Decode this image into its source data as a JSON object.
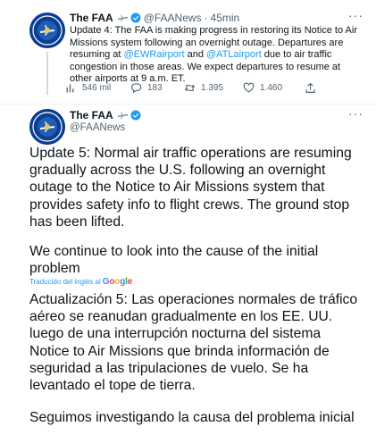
{
  "tweet1": {
    "name": "The FAA",
    "handle": "@FAANews",
    "separator": "·",
    "time": "45min",
    "more": "···",
    "text_part1": "Update 4: The FAA is making progress in restoring its Notice to Air Missions system following an overnight outage. Departures are resuming at ",
    "link1": "@EWRairport",
    "text_and": " and ",
    "link2": "@ATLairport",
    "text_part2": " due to air traffic congestion in those areas. We expect departures to resume at other airports at 9 a.m. ET.",
    "actions": {
      "views": "546 mil",
      "replies": "183",
      "retweets": "1.395",
      "likes": "1.460"
    }
  },
  "tweet2": {
    "name": "The FAA",
    "handle": "@FAANews",
    "more": "···",
    "paragraph1": "Update 5: Normal air traffic operations are resuming gradually across the U.S. following an overnight outage to the Notice to Air Missions system that provides safety info to flight crews. The ground stop has been lifted.",
    "paragraph2": "We continue to look into the cause of the initial problem",
    "translated_by": "Traducido del inglés al",
    "google": [
      "G",
      "o",
      "o",
      "g",
      "l",
      "e"
    ],
    "translation1": "Actualización 5: Las operaciones normales de tráfico aéreo se reanudan gradualmente en los EE. UU. luego de una interrupción nocturna del sistema Notice to Air Missions que brinda información de seguridad a las tripulaciones de vuelo. Se ha levantado el tope de tierra.",
    "translation2": "Seguimos investigando la causa del problema inicial"
  },
  "colors": {
    "link": "#1d9bf0",
    "secondary_text": "#536471",
    "verified": "#1d9bf0",
    "avatar_bg": "#0b3d91"
  },
  "icons": [
    "airplane-icon",
    "verified-badge-icon",
    "views-icon",
    "reply-icon",
    "retweet-icon",
    "like-icon",
    "share-icon",
    "more-icon",
    "faa-seal-icon"
  ]
}
